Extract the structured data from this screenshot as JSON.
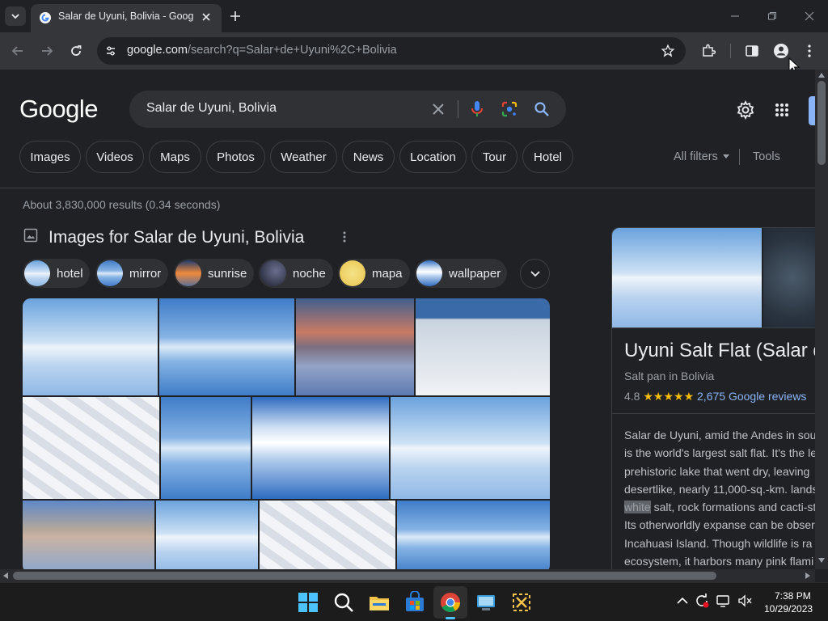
{
  "browser": {
    "tab_title": "Salar de Uyuni, Bolivia - Google",
    "url_host": "google.com",
    "url_path": "/search?q=Salar+de+Uyuni%2C+Bolivia"
  },
  "search": {
    "logo": "Google",
    "query": "Salar de Uyuni, Bolivia"
  },
  "filters": [
    "Images",
    "Videos",
    "Maps",
    "Photos",
    "Weather",
    "News",
    "Location",
    "Tour",
    "Hotel"
  ],
  "tools": {
    "all_filters": "All filters",
    "tools": "Tools"
  },
  "results_stats": "About 3,830,000 results (0.34 seconds)",
  "images_section": {
    "title": "Images for Salar de Uyuni, Bolivia",
    "chips": [
      "hotel",
      "mirror",
      "sunrise",
      "noche",
      "mapa",
      "wallpaper"
    ]
  },
  "knowledge_panel": {
    "title": "Uyuni Salt Flat (Salar d",
    "subtitle": "Salt pan in Bolivia",
    "rating": "4.8",
    "stars": "★★★★★",
    "reviews": "2,675 Google reviews",
    "description_lines": [
      "Salar de Uyuni, amid the Andes in sou",
      "is the world's largest salt flat. It's the le",
      "prehistoric lake that went dry, leaving",
      "desertlike, nearly 11,000-sq.-km. lands",
      "salt, rock formations and cacti-st",
      "Its otherworldly expanse can be obser",
      "Incahuasi Island. Though wildlife is ra",
      "ecosystem, it harbors many pink flami"
    ],
    "highlight_word": "white"
  },
  "taskbar": {
    "time": "7:38 PM",
    "date": "10/29/2023"
  },
  "colors": {
    "accent_blue": "#8ab4f8",
    "star_gold": "#fbbc04",
    "page_bg": "#202124"
  }
}
